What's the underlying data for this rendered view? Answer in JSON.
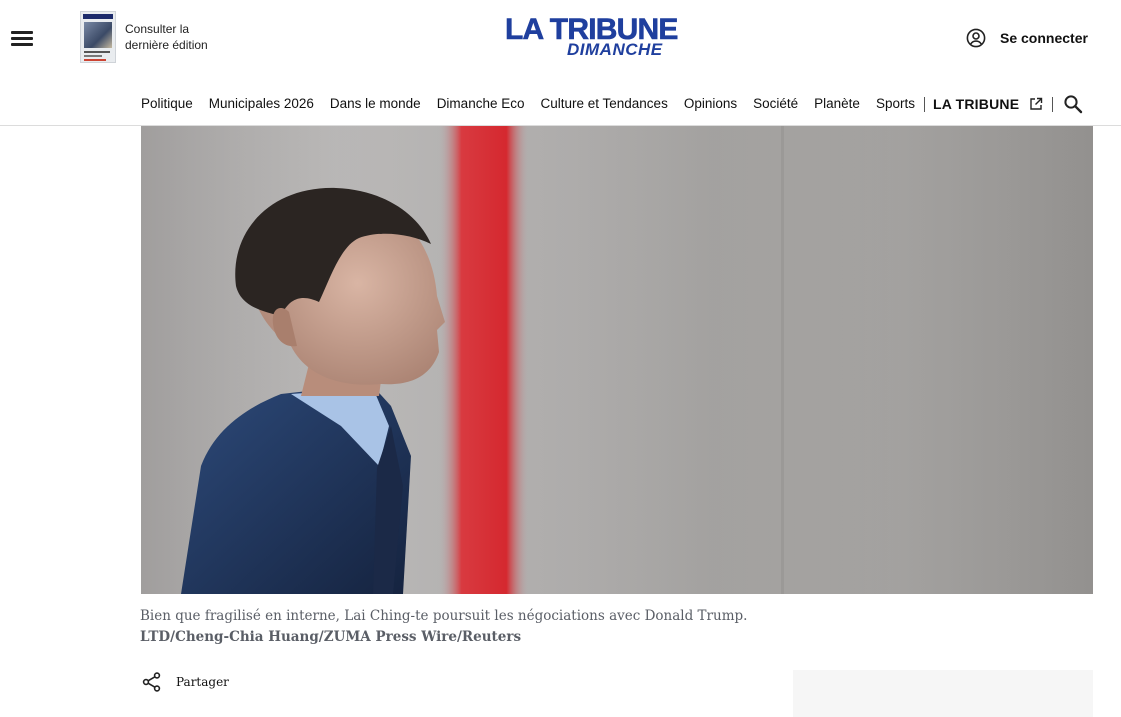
{
  "header": {
    "edition_label": "Consulter la dernière édition",
    "logo_line1": "LA TRIBUNE",
    "logo_line2": "DIMANCHE",
    "login_label": "Se connecter"
  },
  "nav": {
    "items": [
      "Politique",
      "Municipales 2026",
      "Dans le monde",
      "Dimanche Eco",
      "Culture et Tendances",
      "Opinions",
      "Société",
      "Planète",
      "Sports"
    ],
    "brand_link": "LA TRIBUNE"
  },
  "article": {
    "caption": "Bien que fragilisé en interne, Lai Ching-te poursuit les négociations avec Donald Trump.",
    "credit": "LTD/Cheng-Chia Huang/ZUMA Press Wire/Reuters",
    "share_label": "Partager"
  },
  "colors": {
    "brand_blue": "#1f3f9e",
    "caption_grey": "#5a5e66",
    "accent_red": "#d42a2e"
  }
}
